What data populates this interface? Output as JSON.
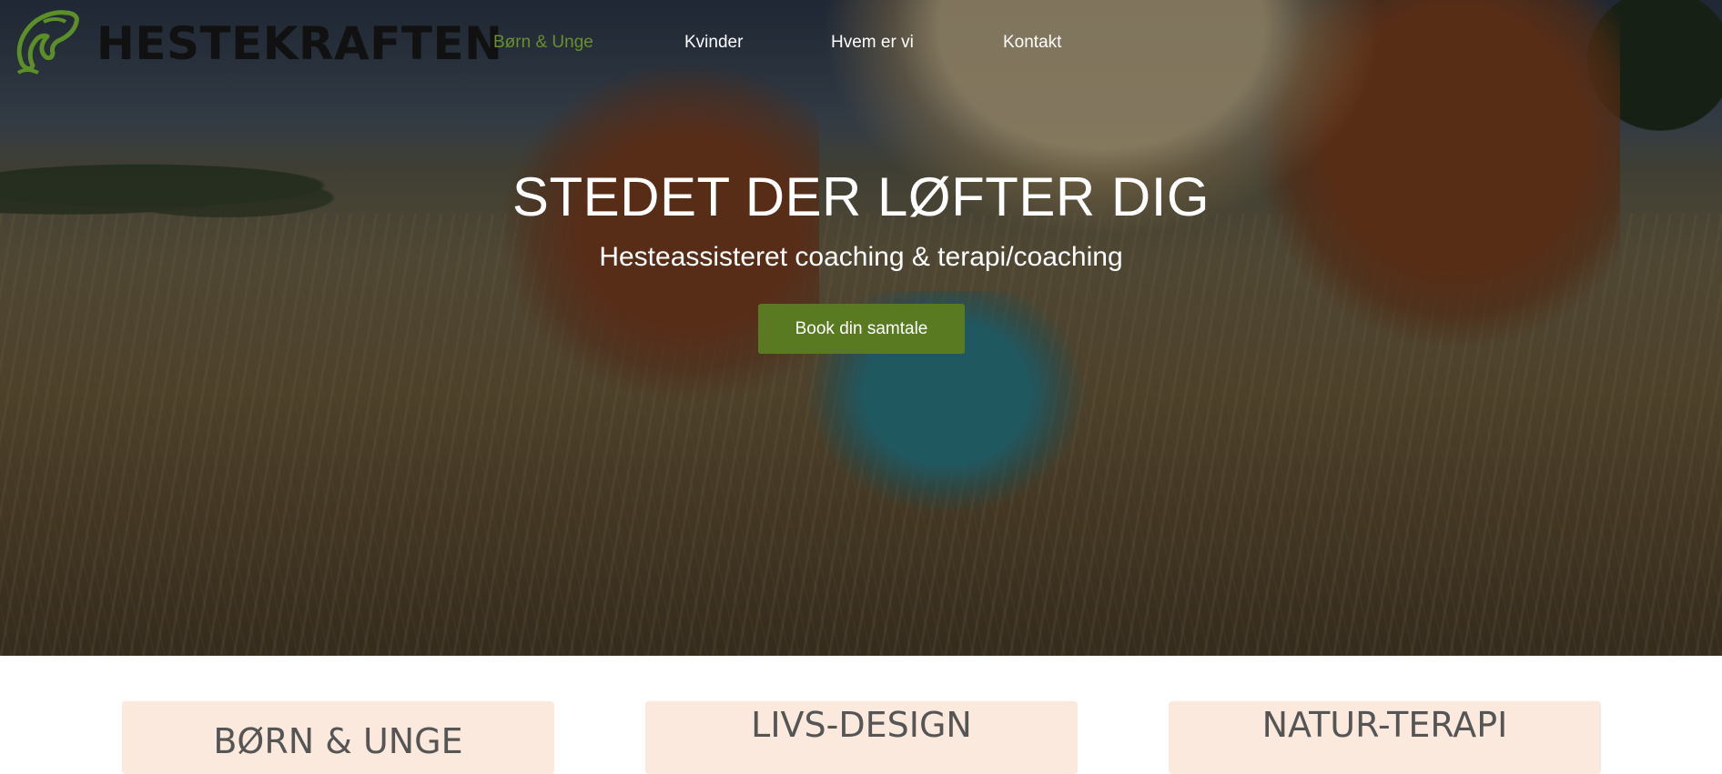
{
  "brand": {
    "name": "HESTEKRAFTEN"
  },
  "nav": {
    "items": [
      {
        "label": "Børn & Unge",
        "active": true
      },
      {
        "label": "Kvinder",
        "active": false
      },
      {
        "label": "Hvem er vi",
        "active": false
      },
      {
        "label": "Kontakt",
        "active": false
      }
    ]
  },
  "hero": {
    "title": "STEDET DER LØFTER DIG",
    "subtitle": "Hesteassisteret coaching & terapi/coaching",
    "cta_label": "Book din samtale"
  },
  "cards": [
    {
      "title": "BØRN & UNGE"
    },
    {
      "title": "LIVS-DESIGN"
    },
    {
      "title": "NATUR-TERAPI"
    }
  ],
  "colors": {
    "accent_green": "#5a7a22",
    "active_nav": "#6a8f2e",
    "card_bg": "#fbe9dd"
  }
}
